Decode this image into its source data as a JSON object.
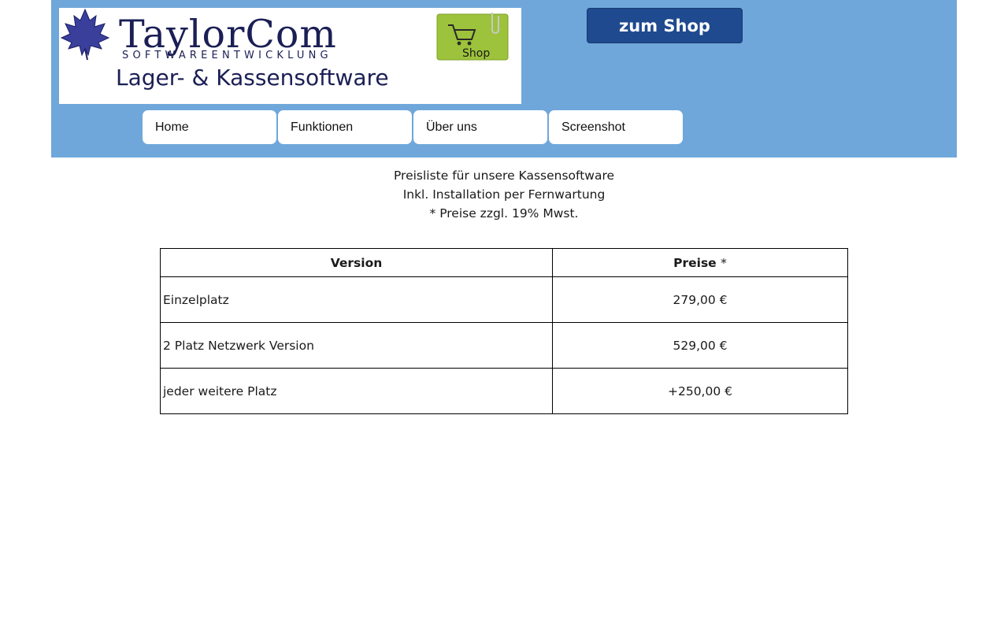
{
  "logo": {
    "brand": "TaylorCom",
    "brand_subtitle": "SOFTWAREENTWICKLUNG",
    "product_line": "Lager- & Kassensoftware",
    "badge": "Shop",
    "colors": {
      "brand_text": "#1b1f55",
      "leaf": "#3a3f9c",
      "badge_bg": "#9cc33b"
    }
  },
  "header": {
    "shop_button": "zum Shop",
    "background": "#6fa7db"
  },
  "nav": {
    "items": [
      {
        "label": "Home"
      },
      {
        "label": "Funktionen"
      },
      {
        "label": "Über uns"
      },
      {
        "label": "Screenshot"
      }
    ]
  },
  "intro": {
    "line1": "Preisliste für unsere Kassensoftware",
    "line2": "Inkl. Installation per Fernwartung",
    "line3": "* Preise zzgl. 19% Mwst."
  },
  "price_table": {
    "headers": {
      "version": "Version",
      "price": "Preise",
      "price_marker": "*"
    },
    "rows": [
      {
        "version": "Einzelplatz",
        "price": "279,00 €"
      },
      {
        "version": "2 Platz Netzwerk Version",
        "price": "529,00 €"
      },
      {
        "version": "jeder weitere Platz",
        "price": "+250,00 €"
      }
    ]
  }
}
